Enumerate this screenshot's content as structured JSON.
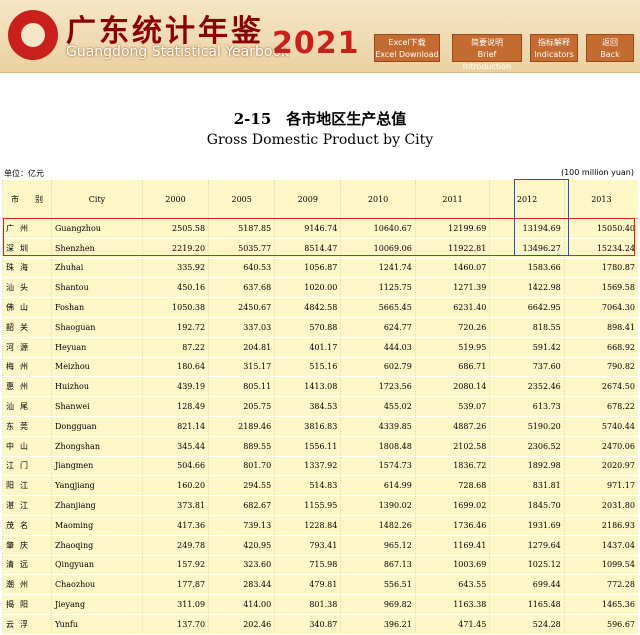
{
  "header": {
    "title_cn": "广东统计年鉴",
    "title_en": "Guangdong Statistical Yearbook",
    "year": "2021",
    "nav": [
      {
        "line1": "Excel下载",
        "line2": "Excel Download"
      },
      {
        "line1": "简要说明",
        "line2": "Brief Introduction"
      },
      {
        "line1": "指标解释",
        "line2": "Indicators"
      },
      {
        "line1": "返回",
        "line2": "Back"
      }
    ]
  },
  "table": {
    "title_cn": "2-15　各市地区生产总值",
    "title_en": "Gross Domestic Product by City",
    "unit_cn": "单位：亿元",
    "unit_en": "(100 million yuan)",
    "headers": {
      "city_cn": "市　　别",
      "city_en": "City",
      "years": [
        "2000",
        "2005",
        "2009",
        "2010",
        "2011",
        "2012",
        "2013"
      ]
    },
    "rows": [
      {
        "cn": "广州",
        "en": "Guangzhou",
        "v": [
          "2505.58",
          "5187.85",
          "9146.74",
          "10640.67",
          "12199.69",
          "13194.69",
          "15050.40"
        ]
      },
      {
        "cn": "深圳",
        "en": "Shenzhen",
        "v": [
          "2219.20",
          "5035.77",
          "8514.47",
          "10069.06",
          "11922.81",
          "13496.27",
          "15234.24"
        ]
      },
      {
        "cn": "珠海",
        "en": "Zhuhai",
        "v": [
          "335.92",
          "640.53",
          "1056.87",
          "1241.74",
          "1460.07",
          "1583.66",
          "1780.87"
        ]
      },
      {
        "cn": "汕头",
        "en": "Shantou",
        "v": [
          "450.16",
          "637.68",
          "1020.00",
          "1125.75",
          "1271.39",
          "1422.98",
          "1569.58"
        ]
      },
      {
        "cn": "佛山",
        "en": "Foshan",
        "v": [
          "1050.38",
          "2450.67",
          "4842.58",
          "5665.45",
          "6231.40",
          "6642.95",
          "7064.30"
        ]
      },
      {
        "cn": "韶关",
        "en": "Shaoguan",
        "v": [
          "192.72",
          "337.03",
          "570.88",
          "624.77",
          "720.26",
          "818.55",
          "898.41"
        ]
      },
      {
        "cn": "河源",
        "en": "Heyuan",
        "v": [
          "87.22",
          "204.81",
          "401.17",
          "444.03",
          "519.95",
          "591.42",
          "668.92"
        ]
      },
      {
        "cn": "梅州",
        "en": "Meizhou",
        "v": [
          "180.64",
          "315.17",
          "515.16",
          "602.79",
          "686.71",
          "737.60",
          "790.82"
        ]
      },
      {
        "cn": "惠州",
        "en": "Huizhou",
        "v": [
          "439.19",
          "805.11",
          "1413.08",
          "1723.56",
          "2080.14",
          "2352.46",
          "2674.50"
        ]
      },
      {
        "cn": "汕尾",
        "en": "Shanwei",
        "v": [
          "128.49",
          "205.75",
          "384.53",
          "455.02",
          "539.07",
          "613.73",
          "678.22"
        ]
      },
      {
        "cn": "东莞",
        "en": "Dongguan",
        "v": [
          "821.14",
          "2189.46",
          "3816.83",
          "4339.85",
          "4887.26",
          "5190.20",
          "5740.44"
        ]
      },
      {
        "cn": "中山",
        "en": "Zhongshan",
        "v": [
          "345.44",
          "889.55",
          "1556.11",
          "1808.48",
          "2102.58",
          "2306.52",
          "2470.06"
        ]
      },
      {
        "cn": "江门",
        "en": "Jiangmen",
        "v": [
          "504.66",
          "801.70",
          "1337.92",
          "1574.73",
          "1836.72",
          "1892.98",
          "2020.97"
        ]
      },
      {
        "cn": "阳江",
        "en": "Yangjiang",
        "v": [
          "160.20",
          "294.55",
          "514.83",
          "614.99",
          "728.68",
          "831.81",
          "971.17"
        ]
      },
      {
        "cn": "湛江",
        "en": "Zhanjiang",
        "v": [
          "373.81",
          "682.67",
          "1155.95",
          "1390.02",
          "1699.02",
          "1845.70",
          "2031.80"
        ]
      },
      {
        "cn": "茂名",
        "en": "Maoming",
        "v": [
          "417.36",
          "739.13",
          "1228.84",
          "1482.26",
          "1736.46",
          "1931.69",
          "2186.93"
        ]
      },
      {
        "cn": "肇庆",
        "en": "Zhaoqing",
        "v": [
          "249.78",
          "420.95",
          "793.41",
          "965.12",
          "1169.41",
          "1279.64",
          "1437.04"
        ]
      },
      {
        "cn": "清远",
        "en": "Qingyuan",
        "v": [
          "157.92",
          "323.60",
          "715.98",
          "867.13",
          "1003.69",
          "1025.12",
          "1099.54"
        ]
      },
      {
        "cn": "潮州",
        "en": "Chaozhou",
        "v": [
          "177.87",
          "283.44",
          "479.81",
          "556.51",
          "643.55",
          "699.44",
          "772.28"
        ]
      },
      {
        "cn": "揭阳",
        "en": "Jieyang",
        "v": [
          "311.09",
          "414.00",
          "801.38",
          "969.82",
          "1163.38",
          "1165.48",
          "1465.36"
        ]
      },
      {
        "cn": "云浮",
        "en": "Yunfu",
        "v": [
          "137.70",
          "202.46",
          "340.87",
          "396.21",
          "471.45",
          "524.28",
          "596.67"
        ]
      }
    ]
  }
}
